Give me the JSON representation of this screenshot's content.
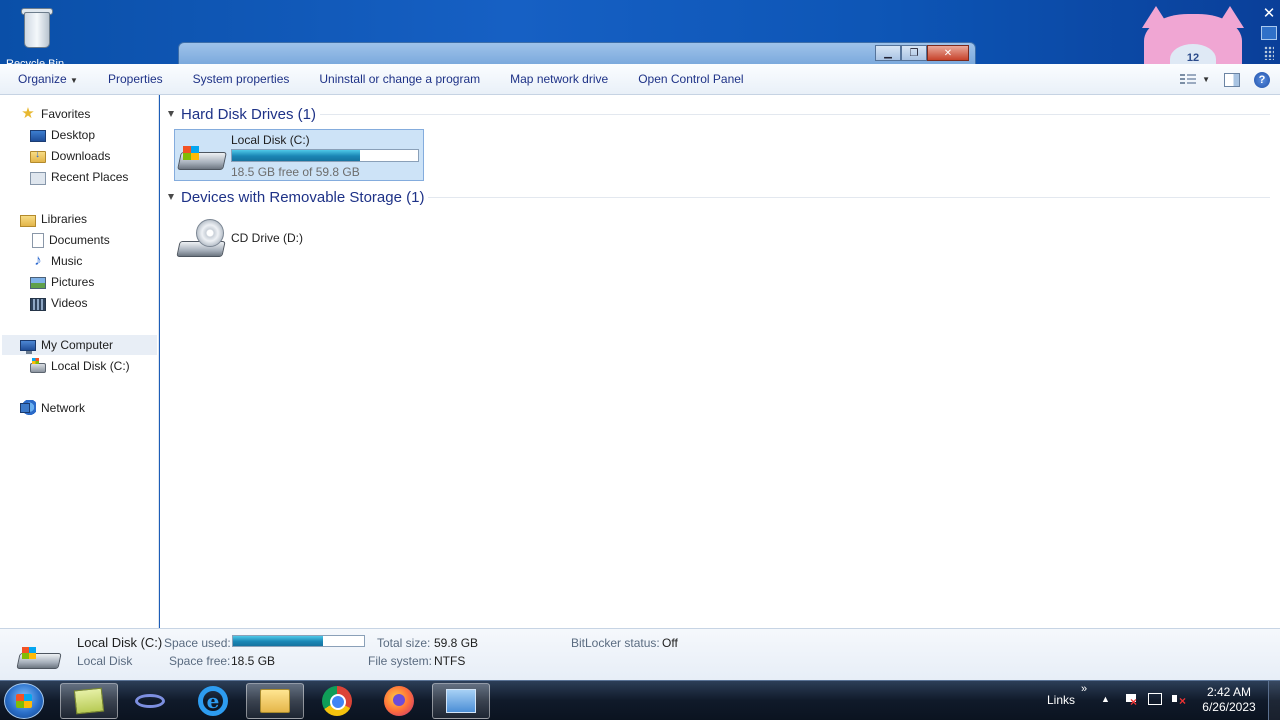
{
  "desktop": {
    "recycle_bin_label": "Recycle Bin",
    "gadget_clock_number": "12"
  },
  "background_window": {
    "minimize": "▁",
    "restore": "❐",
    "close": "✕"
  },
  "toolbar": {
    "organize": "Organize",
    "properties": "Properties",
    "system_properties": "System properties",
    "uninstall": "Uninstall or change a program",
    "map_drive": "Map network drive",
    "open_control_panel": "Open Control Panel",
    "help": "?"
  },
  "nav": {
    "favorites": "Favorites",
    "desktop": "Desktop",
    "downloads": "Downloads",
    "recent_places": "Recent Places",
    "libraries": "Libraries",
    "documents": "Documents",
    "music": "Music",
    "pictures": "Pictures",
    "videos": "Videos",
    "my_computer": "My Computer",
    "local_disk": "Local Disk (C:)",
    "network": "Network"
  },
  "content": {
    "hdd_group": "Hard Disk Drives (1)",
    "removable_group": "Devices with Removable Storage (1)",
    "local_disk": {
      "name": "Local Disk (C:)",
      "free_text": "18.5 GB free of 59.8 GB",
      "used_fraction": 0.69
    },
    "cd_drive": {
      "name": "CD Drive (D:)"
    }
  },
  "details": {
    "name": "Local Disk (C:)",
    "type": "Local Disk",
    "space_used_label": "Space used:",
    "space_free_label": "Space free:",
    "space_free": "18.5 GB",
    "total_size_label": "Total size:",
    "total_size": "59.8 GB",
    "file_system_label": "File system:",
    "file_system": "NTFS",
    "bitlocker_label": "BitLocker status:",
    "bitlocker": "Off",
    "used_fraction": 0.69
  },
  "taskbar": {
    "links": "Links",
    "links_chevron": "»",
    "tray_up": "▲",
    "time": "2:42 AM",
    "date": "6/26/2023"
  }
}
